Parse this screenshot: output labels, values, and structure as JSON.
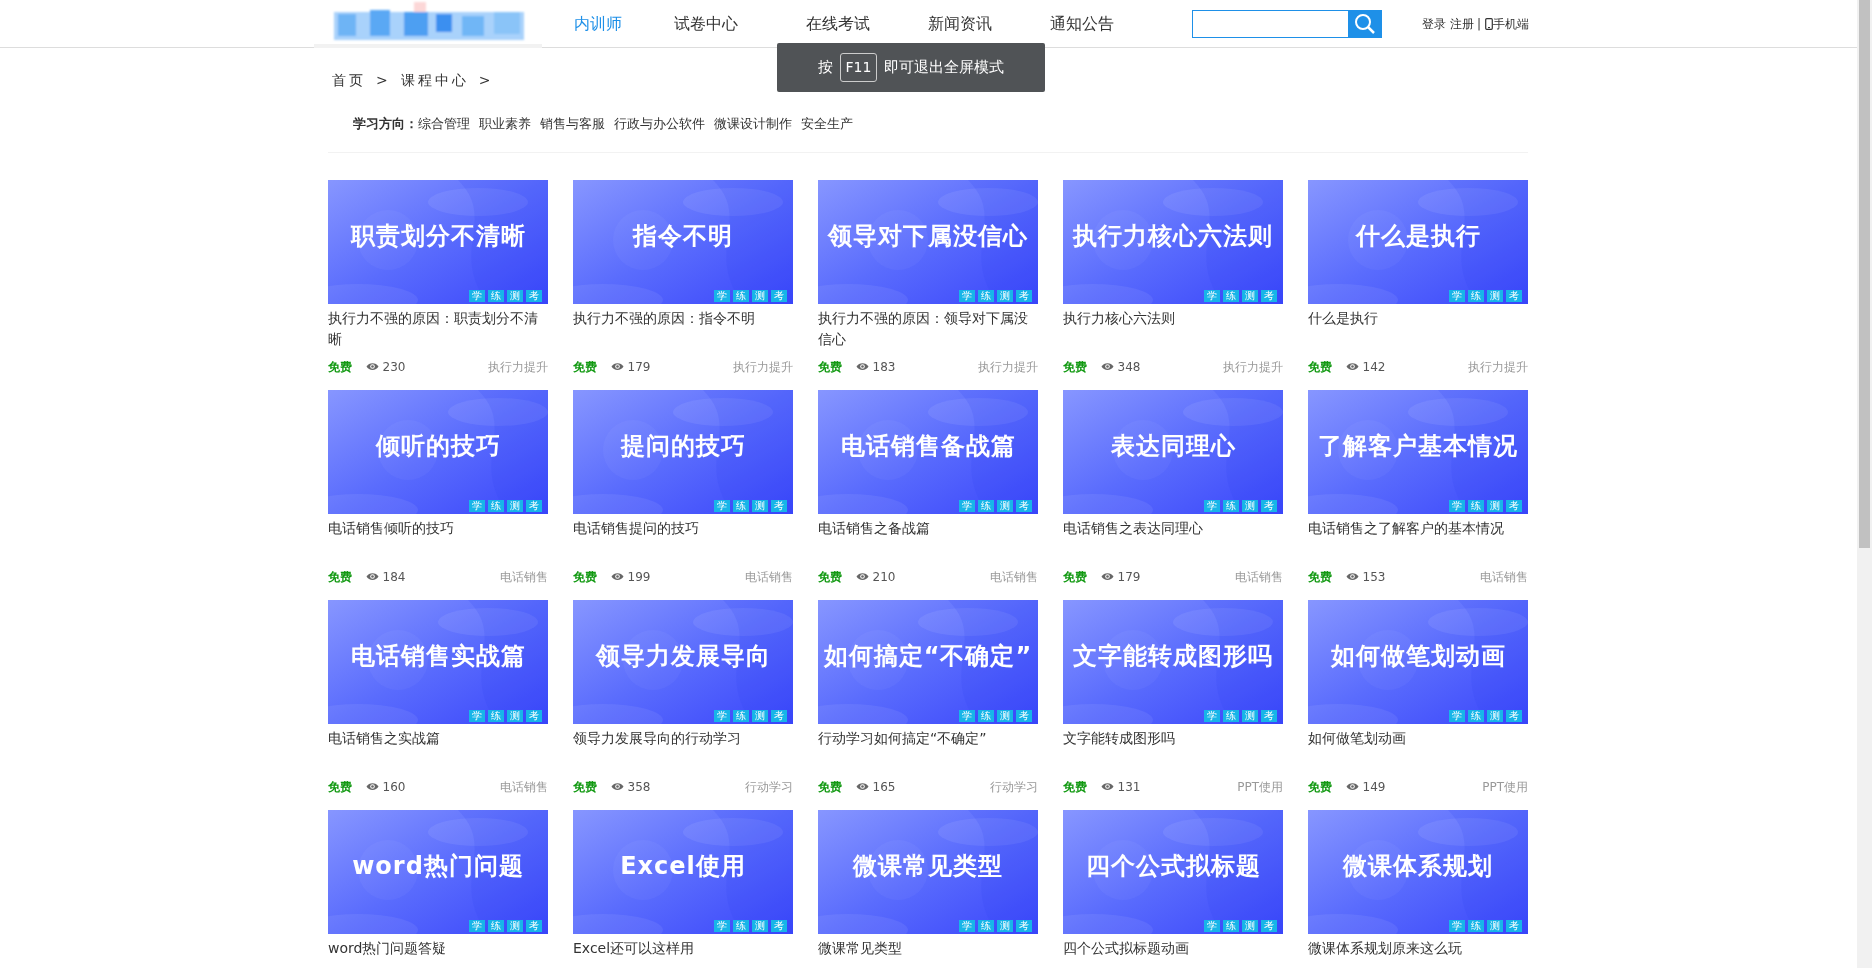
{
  "header": {
    "nav": [
      {
        "label": "内训师",
        "selected": true
      },
      {
        "label": "试卷中心",
        "selected": false
      },
      {
        "label": "在线考试",
        "selected": false
      },
      {
        "label": "新闻资讯",
        "selected": false
      },
      {
        "label": "通知公告",
        "selected": false
      }
    ],
    "user_links": [
      {
        "label": "登录"
      },
      {
        "label": "注册"
      }
    ],
    "separator": "|",
    "mobile": "手机端"
  },
  "toast": {
    "prefix": "按",
    "key": "F11",
    "suffix": "即可退出全屏模式"
  },
  "breadcrumb": [
    {
      "label": "首页"
    },
    {
      "label": "课程中心"
    }
  ],
  "breadcrumb_sep": ">",
  "filter": {
    "label": "学习方向：",
    "options": [
      "综合管理",
      "职业素养",
      "销售与客服",
      "行政与办公软件",
      "微课设计制作",
      "安全生产"
    ]
  },
  "courses": [
    {
      "cover_title": "职责划分不清晰",
      "tags": [
        "学",
        "练",
        "测",
        "考"
      ],
      "title": "执行力不强的原因：职责划分不清晰",
      "price": "免费",
      "views": "230",
      "category": "执行力提升"
    },
    {
      "cover_title": "指令不明",
      "tags": [
        "学",
        "练",
        "测",
        "考"
      ],
      "title": "执行力不强的原因：指令不明",
      "price": "免费",
      "views": "179",
      "category": "执行力提升"
    },
    {
      "cover_title": "领导对下属没信心",
      "tags": [
        "学",
        "练",
        "测",
        "考"
      ],
      "title": "执行力不强的原因：领导对下属没信心",
      "price": "免费",
      "views": "183",
      "category": "执行力提升"
    },
    {
      "cover_title": "执行力核心六法则",
      "tags": [
        "学",
        "练",
        "测",
        "考"
      ],
      "title": "执行力核心六法则",
      "price": "免费",
      "views": "348",
      "category": "执行力提升"
    },
    {
      "cover_title": "什么是执行",
      "tags": [
        "学",
        "练",
        "测",
        "考"
      ],
      "title": "什么是执行",
      "price": "免费",
      "views": "142",
      "category": "执行力提升"
    },
    {
      "cover_title": "倾听的技巧",
      "tags": [
        "学",
        "练",
        "测",
        "考"
      ],
      "title": "电话销售倾听的技巧",
      "price": "免费",
      "views": "184",
      "category": "电话销售"
    },
    {
      "cover_title": "提问的技巧",
      "tags": [
        "学",
        "练",
        "测",
        "考"
      ],
      "title": "电话销售提问的技巧",
      "price": "免费",
      "views": "199",
      "category": "电话销售"
    },
    {
      "cover_title": "电话销售备战篇",
      "tags": [
        "学",
        "练",
        "测",
        "考"
      ],
      "title": "电话销售之备战篇",
      "price": "免费",
      "views": "210",
      "category": "电话销售"
    },
    {
      "cover_title": "表达同理心",
      "tags": [
        "学",
        "练",
        "测",
        "考"
      ],
      "title": "电话销售之表达同理心",
      "price": "免费",
      "views": "179",
      "category": "电话销售"
    },
    {
      "cover_title": "了解客户基本情况",
      "tags": [
        "学",
        "练",
        "测",
        "考"
      ],
      "title": "电话销售之了解客户的基本情况",
      "price": "免费",
      "views": "153",
      "category": "电话销售"
    },
    {
      "cover_title": "电话销售实战篇",
      "tags": [
        "学",
        "练",
        "测",
        "考"
      ],
      "title": "电话销售之实战篇",
      "price": "免费",
      "views": "160",
      "category": "电话销售"
    },
    {
      "cover_title": "领导力发展导向",
      "tags": [
        "学",
        "练",
        "测",
        "考"
      ],
      "title": "领导力发展导向的行动学习",
      "price": "免费",
      "views": "358",
      "category": "行动学习"
    },
    {
      "cover_title": "如何搞定“不确定”",
      "tags": [
        "学",
        "练",
        "测",
        "考"
      ],
      "title": "行动学习如何搞定“不确定”",
      "price": "免费",
      "views": "165",
      "category": "行动学习"
    },
    {
      "cover_title": "文字能转成图形吗",
      "tags": [
        "学",
        "练",
        "测",
        "考"
      ],
      "title": "文字能转成图形吗",
      "price": "免费",
      "views": "131",
      "category": "PPT使用"
    },
    {
      "cover_title": "如何做笔划动画",
      "tags": [
        "学",
        "练",
        "测",
        "考"
      ],
      "title": "如何做笔划动画",
      "price": "免费",
      "views": "149",
      "category": "PPT使用"
    },
    {
      "cover_title": "word热门问题",
      "tags": [
        "学",
        "练",
        "测",
        "考"
      ],
      "title": "word热门问题答疑"
    },
    {
      "cover_title": "Excel使用",
      "tags": [
        "学",
        "练",
        "测",
        "考"
      ],
      "title": "Excel还可以这样用"
    },
    {
      "cover_title": "微课常见类型",
      "tags": [
        "学",
        "练",
        "测",
        "考"
      ],
      "title": "微课常见类型"
    },
    {
      "cover_title": "四个公式拟标题",
      "tags": [
        "学",
        "练",
        "测",
        "考"
      ],
      "title": "四个公式拟标题动画"
    },
    {
      "cover_title": "微课体系规划",
      "tags": [
        "学",
        "练",
        "测",
        "考"
      ],
      "title": "微课体系规划原来这么玩"
    }
  ]
}
